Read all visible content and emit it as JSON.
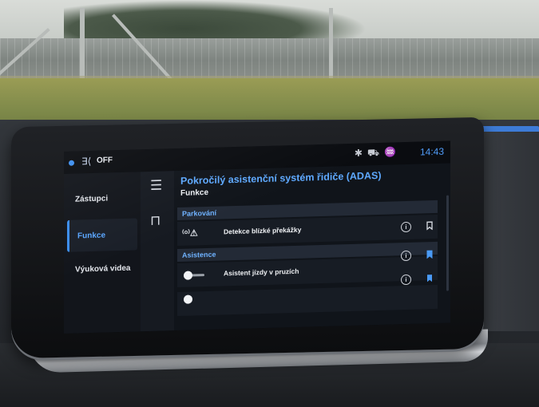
{
  "status_bar": {
    "fan_icon": "fan-icon",
    "fan_state": "OFF",
    "icons": [
      "bluetooth-icon",
      "car-connect-icon",
      "signal-icon"
    ],
    "time": "14:43"
  },
  "sidebar": {
    "items": [
      {
        "label": "Zástupci",
        "active": false
      },
      {
        "label": "Funkce",
        "active": true
      },
      {
        "label": "Výuková videa",
        "active": false
      }
    ]
  },
  "rail": {
    "menu_icon": "menu-icon",
    "car_icon": "car-icon"
  },
  "content": {
    "title": "Pokročilý asistenční systém řidiče (ADAS)",
    "subtitle": "Funkce",
    "sections": [
      {
        "label": "Parkování",
        "rows": [
          {
            "icon": "obstacle-warning-icon",
            "label": "Detekce blízké překážky",
            "info": "info-icon",
            "bookmark": "bookmark-outline-icon",
            "bookmarked": false
          }
        ]
      },
      {
        "label": "Asistence",
        "rows": [
          {
            "icon": "toggle-switch",
            "label": "Asistent jízdy v pruzích",
            "info": "info-icon",
            "bookmark": "bookmark-filled-icon",
            "bookmarked": true
          }
        ]
      }
    ]
  },
  "colors": {
    "accent": "#3b8df0",
    "title": "#5ea9ff",
    "display_bg": "#0d1016"
  }
}
